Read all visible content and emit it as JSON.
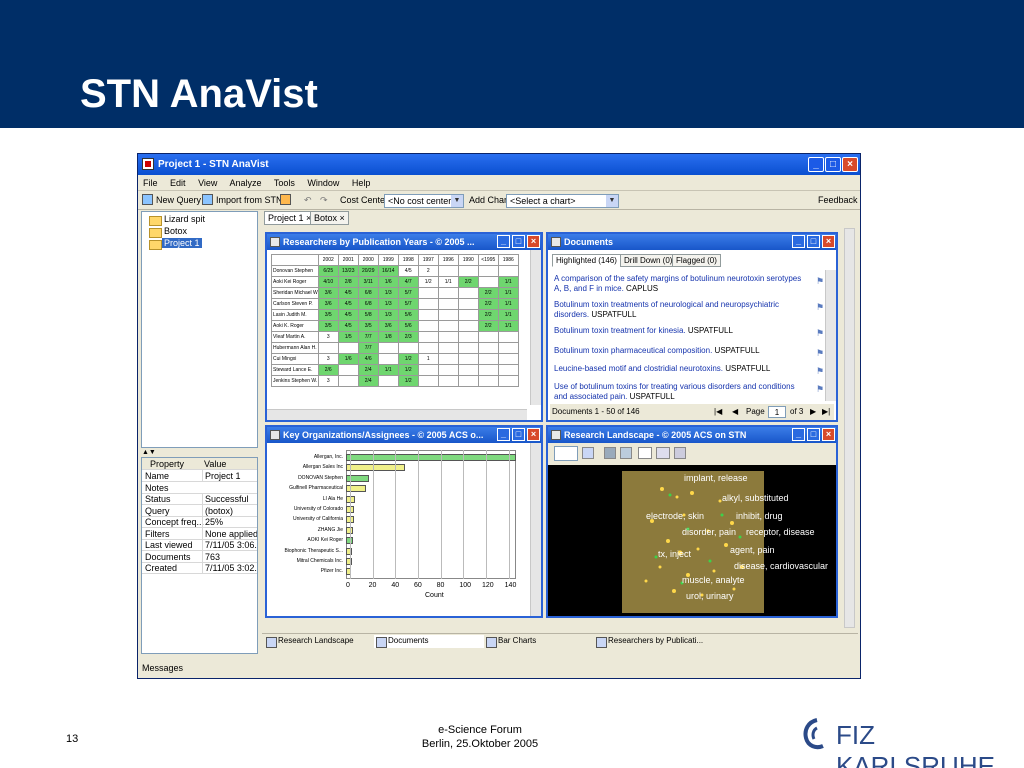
{
  "slide": {
    "title": "STN AnaVist",
    "page_number": "13",
    "footer_line1": "e-Science Forum",
    "footer_line2": "Berlin, 25.Oktober 2005",
    "logo_text": "FIZ KARLSRUHE",
    "banner_color": "#002e67"
  },
  "app": {
    "title": "Project 1 - STN AnaVist",
    "menu": [
      "File",
      "Edit",
      "View",
      "Analyze",
      "Tools",
      "Window",
      "Help"
    ],
    "toolbar": {
      "new_query": "New Query",
      "import": "Import from STN",
      "cost_center_label": "Cost Center:",
      "cost_center_value": "<No cost center>",
      "add_chart_label": "Add Chart:",
      "add_chart_value": "<Select a chart>",
      "feedback": "Feedback"
    },
    "tree": [
      "Lizard spit",
      "Botox",
      "Project 1"
    ],
    "properties": {
      "header_property": "Property",
      "header_value": "Value",
      "rows": [
        [
          "Name",
          "Project 1"
        ],
        [
          "Notes",
          ""
        ],
        [
          "Status",
          "Successful"
        ],
        [
          "Query",
          "(botox)"
        ],
        [
          "Concept freq...",
          "25%"
        ],
        [
          "Filters",
          "None applied"
        ],
        [
          "Last viewed",
          "7/11/05 3:06..."
        ],
        [
          "Documents",
          "763"
        ],
        [
          "Created",
          "7/11/05 3:02..."
        ]
      ]
    },
    "doc_tabs": [
      "Project 1",
      "Botox"
    ],
    "researchers": {
      "title": "Researchers by Publication Years - © 2005 ...",
      "columns": [
        "2002",
        "2001",
        "2000",
        "1999",
        "1998",
        "1997",
        "1996",
        "1990",
        "<1995",
        "1986"
      ],
      "rows": [
        {
          "name": "Donovan Stephen",
          "cells": [
            "6/25",
            "13/23",
            "20/29",
            "16/14",
            "4/5",
            "2",
            "",
            "",
            "",
            ""
          ],
          "green": [
            1,
            1,
            1,
            1,
            0,
            0,
            0,
            0,
            0,
            0
          ]
        },
        {
          "name": "Aoki Kei Roger",
          "cells": [
            "4/10",
            "2/8",
            "3/11",
            "1/6",
            "4/7",
            "1/2",
            "1/1",
            "2/2",
            "",
            "1/1"
          ],
          "green": [
            1,
            1,
            1,
            1,
            1,
            0,
            0,
            1,
            0,
            1
          ]
        },
        {
          "name": "Sheridan Michael W",
          "cells": [
            "3/6",
            "4/5",
            "6/8",
            "1/3",
            "5/7",
            "",
            "",
            "",
            "2/2",
            "1/1"
          ],
          "green": [
            1,
            1,
            1,
            1,
            1,
            0,
            0,
            0,
            1,
            1
          ]
        },
        {
          "name": "Carlson Steven P.",
          "cells": [
            "3/6",
            "4/5",
            "6/8",
            "1/3",
            "5/7",
            "",
            "",
            "",
            "2/2",
            "1/1"
          ],
          "green": [
            1,
            1,
            1,
            1,
            1,
            0,
            0,
            0,
            1,
            1
          ]
        },
        {
          "name": "Lasin Judith M.",
          "cells": [
            "3/5",
            "4/5",
            "5/8",
            "1/3",
            "5/6",
            "",
            "",
            "",
            "2/2",
            "1/1"
          ],
          "green": [
            1,
            1,
            1,
            1,
            1,
            0,
            0,
            0,
            1,
            1
          ]
        },
        {
          "name": "Aoki K. Roger",
          "cells": [
            "3/5",
            "4/5",
            "3/5",
            "3/6",
            "5/6",
            "",
            "",
            "",
            "2/2",
            "1/1"
          ],
          "green": [
            1,
            1,
            1,
            1,
            1,
            0,
            0,
            0,
            1,
            1
          ]
        },
        {
          "name": "Vleaf Martin A.",
          "cells": [
            "3",
            "1/5",
            "7/7",
            "1/8",
            "2/3",
            "",
            "",
            "",
            "",
            ""
          ],
          "green": [
            0,
            1,
            1,
            1,
            1,
            0,
            0,
            0,
            0,
            0
          ]
        },
        {
          "name": "Hubermann Alan H.",
          "cells": [
            "",
            "",
            "7/7",
            "",
            "",
            "",
            "",
            "",
            "",
            ""
          ],
          "green": [
            0,
            0,
            1,
            0,
            0,
            0,
            0,
            0,
            0,
            0
          ]
        },
        {
          "name": "Cui Mingxi",
          "cells": [
            "3",
            "1/6",
            "4/6",
            "",
            "1/2",
            "1",
            "",
            "",
            "",
            ""
          ],
          "green": [
            0,
            1,
            1,
            0,
            1,
            0,
            0,
            0,
            0,
            0
          ]
        },
        {
          "name": "Steward Lance E.",
          "cells": [
            "2/6",
            "",
            "2/4",
            "1/1",
            "1/2",
            "",
            "",
            "",
            "",
            ""
          ],
          "green": [
            1,
            0,
            1,
            1,
            1,
            0,
            0,
            0,
            0,
            0
          ]
        },
        {
          "name": "Jenkins Stephen W.",
          "cells": [
            "3",
            "",
            "2/4",
            "",
            "1/2",
            "",
            "",
            "",
            "",
            ""
          ],
          "green": [
            0,
            0,
            1,
            0,
            1,
            0,
            0,
            0,
            0,
            0
          ]
        }
      ]
    },
    "documents": {
      "title": "Documents",
      "tabs": [
        "Highlighted (146)",
        "Drill Down (0)",
        "Flagged (0)"
      ],
      "items": [
        {
          "text": "A comparison of the safety margins of botulinum neurotoxin serotypes A, B, and F in mice.",
          "source": "CAPLUS"
        },
        {
          "text": "Botulinum toxin treatments of neurological and neuropsychiatric disorders.",
          "source": "USPATFULL"
        },
        {
          "text": "Botulinum toxin treatment for kinesia.",
          "source": "USPATFULL"
        },
        {
          "text": "Botulinum toxin pharmaceutical composition.",
          "source": "USPATFULL"
        },
        {
          "text": "Leucine-based motif and clostridial neurotoxins.",
          "source": "USPATFULL"
        },
        {
          "text": "Use of botulinum toxins for treating various disorders and conditions and associated pain.",
          "source": "USPATFULL"
        }
      ],
      "range": "Documents 1 - 50 of 146",
      "page_label": "Page",
      "page_value": "1",
      "of_label": "of 3"
    },
    "organizations": {
      "title": "Key Organizations/Assignees - © 2005 ACS o...",
      "xlabel": "Count",
      "ticks": [
        "0",
        "20",
        "40",
        "60",
        "80",
        "100",
        "120",
        "140"
      ]
    },
    "landscape": {
      "title": "Research Landscape - © 2005 ACS on STN",
      "labels": [
        "implant, release",
        "alkyl, substituted",
        "electrode, skin",
        "inhibit, drug",
        "disorder, pain",
        "receptor, disease",
        "agent, pain",
        "tx, inject",
        "disease, cardiovascular",
        "muscle, analyte",
        "urol, urinary"
      ]
    },
    "bottom_tabs": [
      "Research Landscape",
      "Documents",
      "Bar Charts",
      "Researchers by Publicati..."
    ],
    "status": "Messages"
  },
  "chart_data": {
    "type": "bar",
    "title": "Key Organizations/Assignees - © 2005 ACS o...",
    "xlabel": "Count",
    "ylabel": "",
    "xlim": [
      0,
      150
    ],
    "categories": [
      "Allergan, Inc.",
      "Allergan Sales Inc",
      "DONOVAN Stephen",
      "Gulfinell Pharmaceutical",
      "LI Ala He",
      "University of Colorado",
      "University of California",
      "ZHANG Jie",
      "AOKI Kei Roger",
      "Biophonic Therapeutic S...",
      "Mitral Chemicals Inc.",
      "Pfizer Inc."
    ],
    "values": [
      150,
      52,
      20,
      18,
      8,
      7,
      7,
      6,
      6,
      5,
      5,
      4
    ],
    "colors": [
      "#7fd97f",
      "#f0f08a",
      "#7fd97f",
      "#f0f08a",
      "#f0f08a",
      "#f0f08a",
      "#f0f08a",
      "#f0f08a",
      "#7fd97f",
      "#f0f08a",
      "#f0f08a",
      "#f0f08a"
    ]
  }
}
